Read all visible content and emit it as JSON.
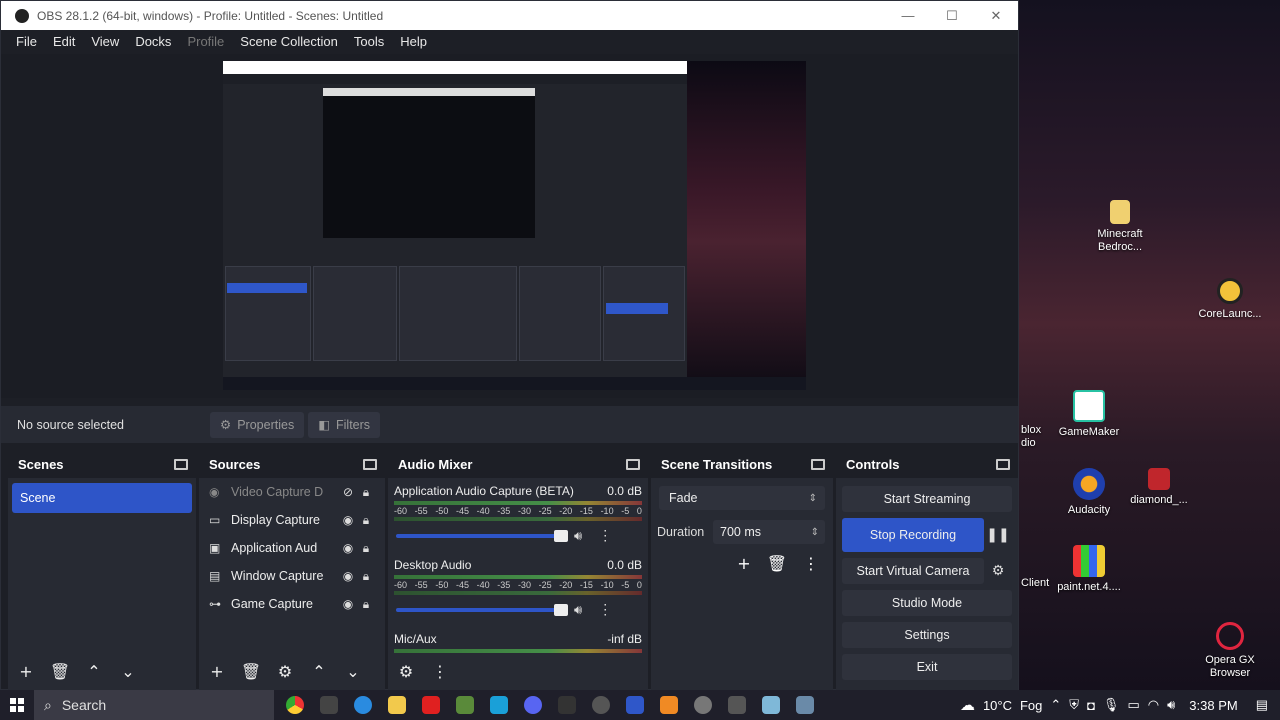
{
  "window": {
    "title": "OBS 28.1.2 (64-bit, windows) - Profile: Untitled - Scenes: Untitled",
    "controls": [
      "—",
      "☐",
      "✕"
    ]
  },
  "menu": [
    "File",
    "Edit",
    "View",
    "Docks",
    "Profile",
    "Scene Collection",
    "Tools",
    "Help"
  ],
  "context_bar": {
    "status": "No source selected",
    "properties": "Properties",
    "filters": "Filters"
  },
  "scenes": {
    "title": "Scenes",
    "items": [
      "Scene"
    ]
  },
  "sources": {
    "title": "Sources",
    "items": [
      {
        "name": "Video Capture D",
        "icon": "camera-icon",
        "visible": false
      },
      {
        "name": "Display Capture",
        "icon": "monitor-icon",
        "visible": true
      },
      {
        "name": "Application Aud",
        "icon": "app-audio-icon",
        "visible": true
      },
      {
        "name": "Window Capture",
        "icon": "window-icon",
        "visible": true
      },
      {
        "name": "Game Capture",
        "icon": "gamepad-icon",
        "visible": true
      }
    ]
  },
  "audio_mixer": {
    "title": "Audio Mixer",
    "ticks": [
      "-60",
      "-55",
      "-50",
      "-45",
      "-40",
      "-35",
      "-30",
      "-25",
      "-20",
      "-15",
      "-10",
      "-5",
      "0"
    ],
    "channels": [
      {
        "name": "Application Audio Capture (BETA)",
        "level": "0.0 dB"
      },
      {
        "name": "Desktop Audio",
        "level": "0.0 dB"
      },
      {
        "name": "Mic/Aux",
        "level": "-inf dB"
      }
    ]
  },
  "scene_transitions": {
    "title": "Scene Transitions",
    "transition": "Fade",
    "duration_label": "Duration",
    "duration_value": "700 ms"
  },
  "controls": {
    "title": "Controls",
    "start_streaming": "Start Streaming",
    "stop_recording": "Stop Recording",
    "start_virtual_camera": "Start Virtual Camera",
    "studio_mode": "Studio Mode",
    "settings": "Settings",
    "exit": "Exit"
  },
  "desktop": {
    "icons": [
      {
        "label": "Minecraft Bedroc...",
        "icon": "folder-icon"
      },
      {
        "label": "CoreLaunc...",
        "icon": "corelauncher-icon"
      },
      {
        "label": "GameMaker",
        "icon": "gamemaker-icon"
      },
      {
        "label": "Audacity",
        "icon": "audacity-icon"
      },
      {
        "label": "diamond_...",
        "icon": "diamond-icon"
      },
      {
        "label": "paint.net.4....",
        "icon": "paintnet-icon"
      },
      {
        "label": "Opera GX Browser",
        "icon": "opera-gx-icon"
      }
    ],
    "partial": [
      "blox",
      "dio",
      "Client"
    ]
  },
  "taskbar": {
    "search": "Search",
    "weather": "10°C",
    "weather_desc": "Fog",
    "time": "3:38 PM"
  },
  "colors": {
    "accent": "#2e55c8",
    "panel": "#272a33",
    "window_bg": "#1d1f26"
  }
}
